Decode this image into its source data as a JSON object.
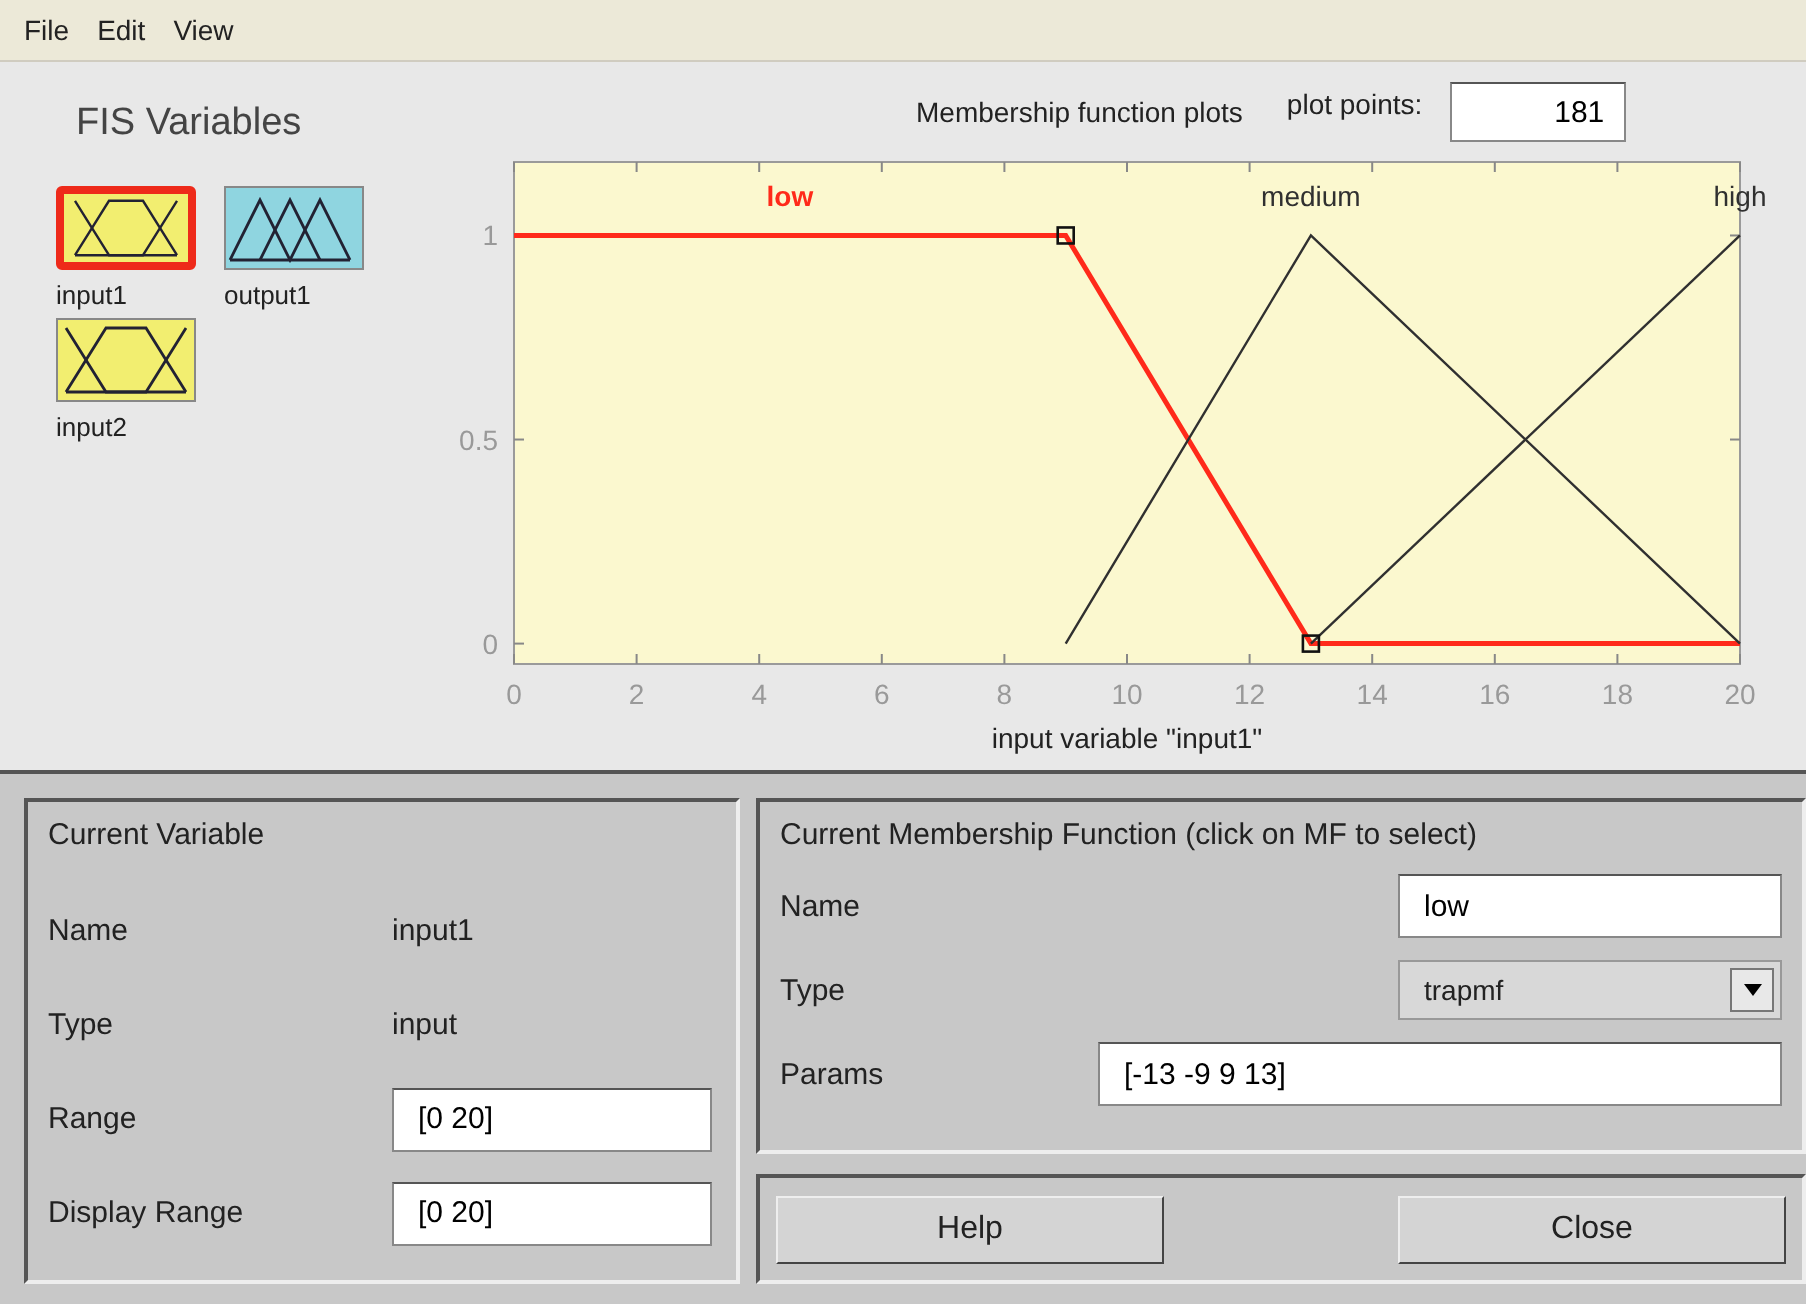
{
  "menu": [
    "File",
    "Edit",
    "View"
  ],
  "fis_variables": {
    "title": "FIS Variables",
    "items": [
      {
        "label": "input1",
        "kind": "input",
        "selected": true
      },
      {
        "label": "output1",
        "kind": "output",
        "selected": false
      },
      {
        "label": "input2",
        "kind": "input",
        "selected": false
      }
    ]
  },
  "plot_header": {
    "title": "Membership function plots",
    "plot_points_label": "plot points:",
    "plot_points": "181"
  },
  "chart_data": {
    "type": "line",
    "xlabel": "input variable \"input1\"",
    "x": [
      0,
      9,
      13,
      20
    ],
    "xlim": [
      0,
      20
    ],
    "ylim": [
      -0.05,
      1.18
    ],
    "xticks": [
      0,
      2,
      4,
      6,
      8,
      10,
      12,
      14,
      16,
      18,
      20
    ],
    "yticks": [
      0,
      0.5,
      1
    ],
    "series": [
      {
        "name": "low",
        "color": "#ff2a1a",
        "values": [
          1,
          1,
          0,
          0
        ]
      },
      {
        "name": "medium",
        "color": "#303030",
        "values": [
          null,
          0,
          1,
          0
        ]
      },
      {
        "name": "high",
        "color": "#303030",
        "values": [
          null,
          null,
          0,
          1
        ]
      }
    ]
  },
  "curve_selection": [
    {
      "selected": true
    },
    {
      "selected": false
    },
    {
      "selected": false
    }
  ],
  "current_variable": {
    "title": "Current Variable",
    "rows": [
      {
        "label": "Name",
        "kind": "text",
        "value": "input1"
      },
      {
        "label": "Type",
        "kind": "text",
        "value": "input"
      },
      {
        "label": "Range",
        "kind": "field",
        "value": "[0 20]"
      },
      {
        "label": "Display Range",
        "kind": "field",
        "value": "[0 20]"
      }
    ]
  },
  "current_mf": {
    "title": "Current Membership Function (click on MF to select)",
    "rows": [
      {
        "label": "Name",
        "kind": "field",
        "value": "low"
      },
      {
        "label": "Type",
        "kind": "dropdown",
        "value": "trapmf"
      },
      {
        "label": "Params",
        "kind": "wide",
        "value": "[-13 -9 9 13]"
      }
    ]
  },
  "buttons": [
    "Help",
    "Close"
  ]
}
